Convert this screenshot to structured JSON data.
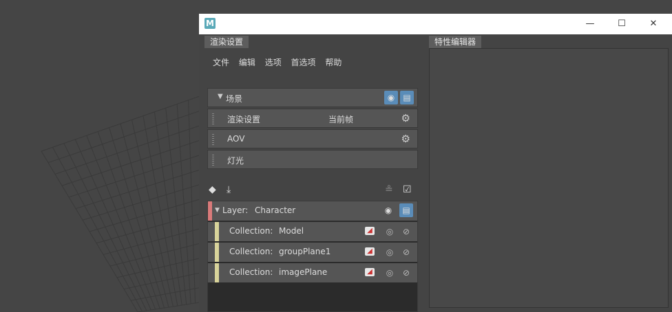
{
  "app": {
    "logo_letter": "M"
  },
  "window_buttons": {
    "minimize": "—",
    "maximize": "☐",
    "close": "✕"
  },
  "tabs": {
    "render_settings": "渲染设置",
    "attribute_editor": "特性编辑器"
  },
  "menubar": {
    "items": [
      "文件",
      "编辑",
      "选项",
      "首选项",
      "帮助"
    ]
  },
  "scene": {
    "header": "场景",
    "rows": [
      {
        "label": "渲染设置",
        "sub": "当前帧"
      },
      {
        "label": "AOV",
        "sub": ""
      },
      {
        "label": "灯光",
        "sub": ""
      }
    ]
  },
  "layer": {
    "prefix": "Layer:",
    "name": "Character"
  },
  "collections": [
    {
      "prefix": "Collection:",
      "name": "Model"
    },
    {
      "prefix": "Collection:",
      "name": "groupPlane1"
    },
    {
      "prefix": "Collection:",
      "name": "imagePlane"
    }
  ],
  "colors": {
    "accent": "#5a8cb8",
    "layer_swatch": "#d97a7a",
    "collection_swatch": "#d8d39a",
    "panel_bg": "#444444"
  },
  "icons": [
    "eye-icon",
    "clapper-icon",
    "gear-icon",
    "create-layer-icon",
    "import-icon",
    "merge-icon",
    "checklist-icon",
    "isolate-icon",
    "disable-icon",
    "material-override-icon"
  ]
}
